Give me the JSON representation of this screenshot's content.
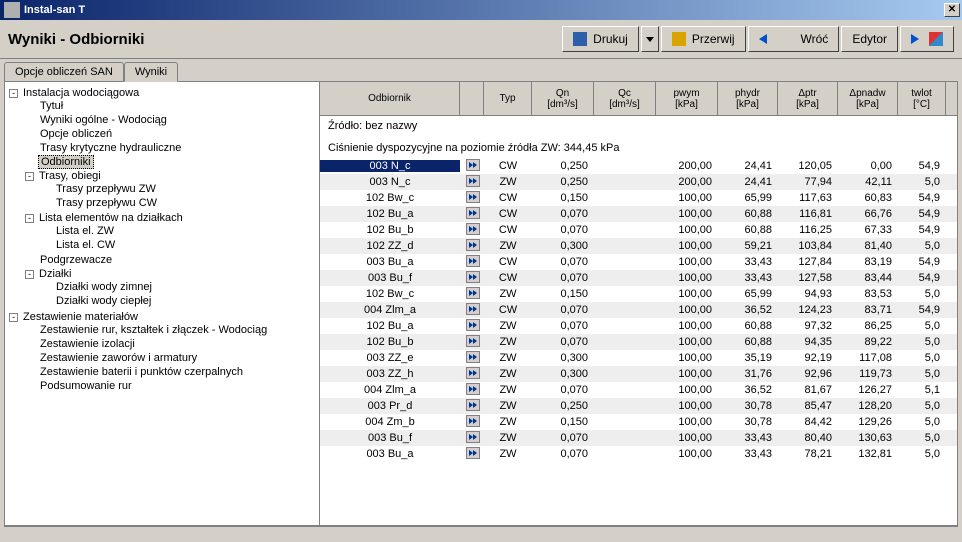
{
  "window": {
    "title": "Instal-san T"
  },
  "header": {
    "title": "Wyniki - Odbiorniki",
    "btn_print": "Drukuj",
    "btn_stop": "Przerwij",
    "btn_back": "Wróć",
    "btn_editor": "Edytor"
  },
  "tabs": {
    "opts": "Opcje obliczeń SAN",
    "results": "Wyniki"
  },
  "tree": {
    "root": "Instalacja wodociągowa",
    "n1": "Tytuł",
    "n2": "Wyniki ogólne - Wodociąg",
    "n3": "Opcje obliczeń",
    "n4": "Trasy krytyczne hydrauliczne",
    "n5": "Odbiorniki",
    "n6": "Trasy, obiegi",
    "n6a": "Trasy przepływu ZW",
    "n6b": "Trasy przepływu CW",
    "n7": "Lista elementów na działkach",
    "n7a": "Lista el. ZW",
    "n7b": "Lista el. CW",
    "n8": "Podgrzewacze",
    "n9": "Działki",
    "n9a": "Działki wody zimnej",
    "n9b": "Działki wody ciepłej",
    "n10": "Zestawienie materiałów",
    "n10a": "Zestawienie rur, kształtek i złączek - Wodociąg",
    "n10b": "Zestawienie izolacji",
    "n10c": "Zestawienie zaworów i armatury",
    "n10d": "Zestawienie baterii i punktów czerpalnych",
    "n10e": "Podsumowanie rur"
  },
  "grid": {
    "headers": {
      "odb": "Odbiornik",
      "typ": "Typ",
      "qn": "Qn",
      "qn_u": "[dm³/s]",
      "qc": "Qc",
      "qc_u": "[dm³/s]",
      "pwym": "pwym",
      "pwym_u": "[kPa]",
      "phydr": "phydr",
      "phydr_u": "[kPa]",
      "dptr": "Δptr",
      "dptr_u": "[kPa]",
      "dpnadw": "Δpnadw",
      "dpnadw_u": "[kPa]",
      "twlot": "twlot",
      "twlot_u": "[°C]"
    },
    "info1": "Źródło: bez nazwy",
    "info2": "Ciśnienie dyspozycyjne na poziomie źródła ZW: 344,45 kPa",
    "rows": [
      {
        "odb": "003 N_c",
        "typ": "CW",
        "qn": "0,250",
        "qc": "",
        "pwym": "200,00",
        "ph": "24,41",
        "dptr": "120,05",
        "dpn": "0,00",
        "tw": "54,9"
      },
      {
        "odb": "003 N_c",
        "typ": "ZW",
        "qn": "0,250",
        "qc": "",
        "pwym": "200,00",
        "ph": "24,41",
        "dptr": "77,94",
        "dpn": "42,11",
        "tw": "5,0"
      },
      {
        "odb": "102 Bw_c",
        "typ": "CW",
        "qn": "0,150",
        "qc": "",
        "pwym": "100,00",
        "ph": "65,99",
        "dptr": "117,63",
        "dpn": "60,83",
        "tw": "54,9"
      },
      {
        "odb": "102 Bu_a",
        "typ": "CW",
        "qn": "0,070",
        "qc": "",
        "pwym": "100,00",
        "ph": "60,88",
        "dptr": "116,81",
        "dpn": "66,76",
        "tw": "54,9"
      },
      {
        "odb": "102 Bu_b",
        "typ": "CW",
        "qn": "0,070",
        "qc": "",
        "pwym": "100,00",
        "ph": "60,88",
        "dptr": "116,25",
        "dpn": "67,33",
        "tw": "54,9"
      },
      {
        "odb": "102 ZZ_d",
        "typ": "ZW",
        "qn": "0,300",
        "qc": "",
        "pwym": "100,00",
        "ph": "59,21",
        "dptr": "103,84",
        "dpn": "81,40",
        "tw": "5,0"
      },
      {
        "odb": "003 Bu_a",
        "typ": "CW",
        "qn": "0,070",
        "qc": "",
        "pwym": "100,00",
        "ph": "33,43",
        "dptr": "127,84",
        "dpn": "83,19",
        "tw": "54,9"
      },
      {
        "odb": "003 Bu_f",
        "typ": "CW",
        "qn": "0,070",
        "qc": "",
        "pwym": "100,00",
        "ph": "33,43",
        "dptr": "127,58",
        "dpn": "83,44",
        "tw": "54,9"
      },
      {
        "odb": "102 Bw_c",
        "typ": "ZW",
        "qn": "0,150",
        "qc": "",
        "pwym": "100,00",
        "ph": "65,99",
        "dptr": "94,93",
        "dpn": "83,53",
        "tw": "5,0"
      },
      {
        "odb": "004 Zlm_a",
        "typ": "CW",
        "qn": "0,070",
        "qc": "",
        "pwym": "100,00",
        "ph": "36,52",
        "dptr": "124,23",
        "dpn": "83,71",
        "tw": "54,9"
      },
      {
        "odb": "102 Bu_a",
        "typ": "ZW",
        "qn": "0,070",
        "qc": "",
        "pwym": "100,00",
        "ph": "60,88",
        "dptr": "97,32",
        "dpn": "86,25",
        "tw": "5,0"
      },
      {
        "odb": "102 Bu_b",
        "typ": "ZW",
        "qn": "0,070",
        "qc": "",
        "pwym": "100,00",
        "ph": "60,88",
        "dptr": "94,35",
        "dpn": "89,22",
        "tw": "5,0"
      },
      {
        "odb": "003 ZZ_e",
        "typ": "ZW",
        "qn": "0,300",
        "qc": "",
        "pwym": "100,00",
        "ph": "35,19",
        "dptr": "92,19",
        "dpn": "117,08",
        "tw": "5,0"
      },
      {
        "odb": "003 ZZ_h",
        "typ": "ZW",
        "qn": "0,300",
        "qc": "",
        "pwym": "100,00",
        "ph": "31,76",
        "dptr": "92,96",
        "dpn": "119,73",
        "tw": "5,0"
      },
      {
        "odb": "004 Zlm_a",
        "typ": "ZW",
        "qn": "0,070",
        "qc": "",
        "pwym": "100,00",
        "ph": "36,52",
        "dptr": "81,67",
        "dpn": "126,27",
        "tw": "5,1"
      },
      {
        "odb": "003 Pr_d",
        "typ": "ZW",
        "qn": "0,250",
        "qc": "",
        "pwym": "100,00",
        "ph": "30,78",
        "dptr": "85,47",
        "dpn": "128,20",
        "tw": "5,0"
      },
      {
        "odb": "004 Zm_b",
        "typ": "ZW",
        "qn": "0,150",
        "qc": "",
        "pwym": "100,00",
        "ph": "30,78",
        "dptr": "84,42",
        "dpn": "129,26",
        "tw": "5,0"
      },
      {
        "odb": "003 Bu_f",
        "typ": "ZW",
        "qn": "0,070",
        "qc": "",
        "pwym": "100,00",
        "ph": "33,43",
        "dptr": "80,40",
        "dpn": "130,63",
        "tw": "5,0"
      },
      {
        "odb": "003 Bu_a",
        "typ": "ZW",
        "qn": "0,070",
        "qc": "",
        "pwym": "100,00",
        "ph": "33,43",
        "dptr": "78,21",
        "dpn": "132,81",
        "tw": "5,0"
      }
    ]
  }
}
